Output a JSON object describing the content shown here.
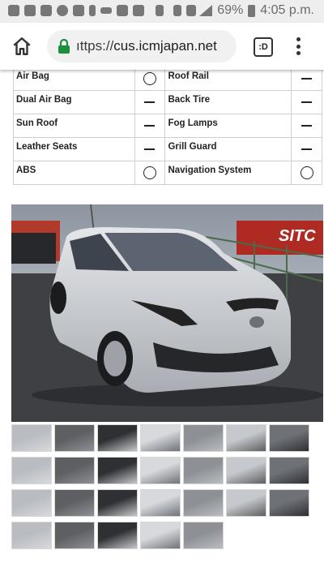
{
  "status_bar": {
    "battery": "69%",
    "time": "4:05 p.m.",
    "icons": [
      "message-icon",
      "facebook-icon",
      "facebook-icon",
      "messenger-icon",
      "gallery-icon",
      "microphone-icon",
      "voicemail-icon",
      "media-icon",
      "youtube-icon",
      "one-icon",
      "mute-icon",
      "wifi-icon",
      "signal-icon",
      "battery-icon"
    ]
  },
  "browser": {
    "url_prefix": "ıttps://",
    "url_host": "cus.icmjapan.net",
    "tab_count": ":D"
  },
  "features": [
    {
      "left": "Air Bag",
      "left_mark": "circle",
      "right": "Roof Rail",
      "right_mark": "dash"
    },
    {
      "left": "Dual Air Bag",
      "left_mark": "dash",
      "right": "Back Tire",
      "right_mark": "dash"
    },
    {
      "left": "Sun Roof",
      "left_mark": "dash",
      "right": "Fog Lamps",
      "right_mark": "dash"
    },
    {
      "left": "Leather Seats",
      "left_mark": "dash",
      "right": "Grill Guard",
      "right_mark": "dash"
    },
    {
      "left": "ABS",
      "left_mark": "circle",
      "right": "Navigation System",
      "right_mark": "circle"
    }
  ],
  "gallery": {
    "main_photo": "silver-hatchback-photo",
    "thumbnails": [
      "front-quarter",
      "engine-bay",
      "dashboard",
      "trunk-mat",
      "side-view",
      "rear-quarter",
      "rear-view",
      "side-profile",
      "front-view",
      "interior-wide",
      "rear-seats",
      "cargo-area",
      "cargo-seats",
      "steering-wheel",
      "wheel",
      "navigation",
      "instrument-panel",
      "door-panel",
      "spare-tire",
      "gear-shift",
      "door-handle",
      "underbody",
      "underbody-rear",
      "exhaust",
      "undercarriage",
      "cockpit"
    ]
  },
  "colors": {
    "status_bg": "#eeeeee",
    "lock_green": "#1e8e3e",
    "car_silver": "#c8cbd0"
  }
}
